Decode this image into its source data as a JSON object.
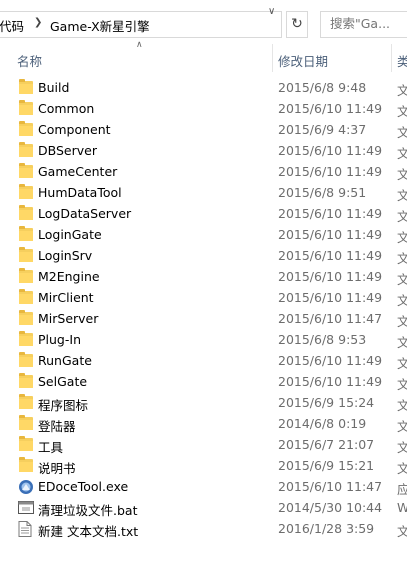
{
  "address": {
    "crumb1": "代码",
    "crumb2": "Game-X新星引擎",
    "search_placeholder": "搜索\"Ga..."
  },
  "columns": {
    "name": "名称",
    "date": "修改日期",
    "type": "类"
  },
  "files": [
    {
      "name": "Build",
      "date": "2015/6/8 9:48",
      "type": "文",
      "kind": "folder"
    },
    {
      "name": "Common",
      "date": "2015/6/10 11:49",
      "type": "文",
      "kind": "folder"
    },
    {
      "name": "Component",
      "date": "2015/6/9 4:37",
      "type": "文",
      "kind": "folder"
    },
    {
      "name": "DBServer",
      "date": "2015/6/10 11:49",
      "type": "文",
      "kind": "folder"
    },
    {
      "name": "GameCenter",
      "date": "2015/6/10 11:49",
      "type": "文",
      "kind": "folder"
    },
    {
      "name": "HumDataTool",
      "date": "2015/6/8 9:51",
      "type": "文",
      "kind": "folder"
    },
    {
      "name": "LogDataServer",
      "date": "2015/6/10 11:49",
      "type": "文",
      "kind": "folder"
    },
    {
      "name": "LoginGate",
      "date": "2015/6/10 11:49",
      "type": "文",
      "kind": "folder"
    },
    {
      "name": "LoginSrv",
      "date": "2015/6/10 11:49",
      "type": "文",
      "kind": "folder"
    },
    {
      "name": "M2Engine",
      "date": "2015/6/10 11:49",
      "type": "文",
      "kind": "folder"
    },
    {
      "name": "MirClient",
      "date": "2015/6/10 11:49",
      "type": "文",
      "kind": "folder"
    },
    {
      "name": "MirServer",
      "date": "2015/6/10 11:47",
      "type": "文",
      "kind": "folder"
    },
    {
      "name": "Plug-In",
      "date": "2015/6/8 9:53",
      "type": "文",
      "kind": "folder"
    },
    {
      "name": "RunGate",
      "date": "2015/6/10 11:49",
      "type": "文",
      "kind": "folder"
    },
    {
      "name": "SelGate",
      "date": "2015/6/10 11:49",
      "type": "文",
      "kind": "folder"
    },
    {
      "name": "程序图标",
      "date": "2015/6/9 15:24",
      "type": "文",
      "kind": "folder"
    },
    {
      "name": "登陆器",
      "date": "2014/6/8 0:19",
      "type": "文",
      "kind": "folder"
    },
    {
      "name": "工具",
      "date": "2015/6/7 21:07",
      "type": "文",
      "kind": "folder"
    },
    {
      "name": "说明书",
      "date": "2015/6/9 15:21",
      "type": "文",
      "kind": "folder"
    },
    {
      "name": "EDoceTool.exe",
      "date": "2015/6/10 11:47",
      "type": "应",
      "kind": "exe"
    },
    {
      "name": "清理垃圾文件.bat",
      "date": "2014/5/30 10:44",
      "type": "W",
      "kind": "bat"
    },
    {
      "name": "新建 文本文档.txt",
      "date": "2016/1/28 3:59",
      "type": "文",
      "kind": "txt"
    }
  ]
}
